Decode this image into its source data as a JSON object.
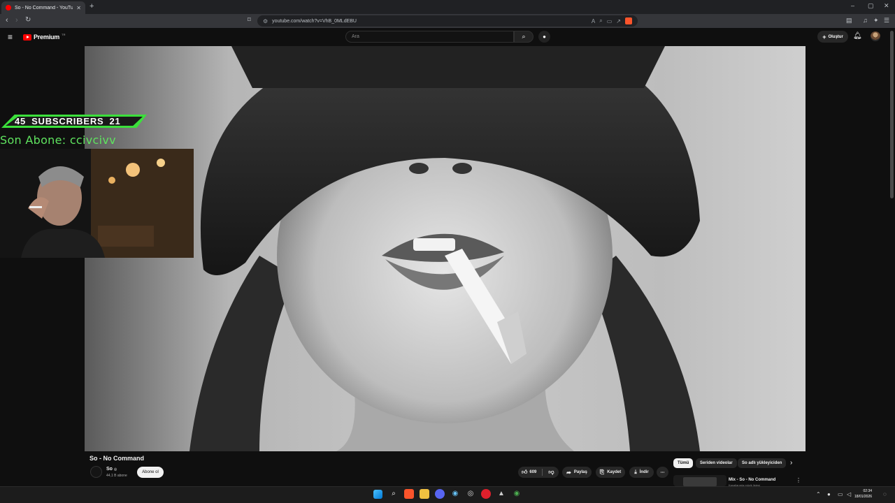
{
  "browser": {
    "tab_title": "So - No Command - YouTube",
    "new_tab": "+",
    "url": "youtube.com/watch?v=VhB_0MLdEBU",
    "window_controls": [
      "–",
      "▢",
      "✕"
    ]
  },
  "youtube": {
    "logo_text": "Premium",
    "logo_sup": "TR",
    "search_placeholder": "Ara",
    "create_label": "Oluştur"
  },
  "overlay": {
    "subscribers_current": "45",
    "subscribers_label": "SUBSCRIBERS",
    "subscribers_goal": "21",
    "last_subscriber": "Son Abone: ccivcivv"
  },
  "video": {
    "title": "So - No Command",
    "channel_name": "So",
    "channel_verified": "◎",
    "channel_subs": "44,1 B abone",
    "subscribe_label": "Abone ol",
    "likes": "609",
    "share_label": "Paylaş",
    "save_label": "Kaydet",
    "download_label": "İndir",
    "more_label": "⋯"
  },
  "sidebar": {
    "chips": [
      "Tümü",
      "Seriden videolar",
      "So adlı yükleyiciden"
    ],
    "mix_title": "Mix - So - No Command",
    "mix_subtitle": "Kanallarımla müzik listesi"
  },
  "taskbar": {
    "time": "02:34",
    "date": "18/01/2026"
  },
  "colors": {
    "accent_green": "#3be03b",
    "youtube_red": "#ff0000",
    "brave_orange": "#fb542b"
  }
}
